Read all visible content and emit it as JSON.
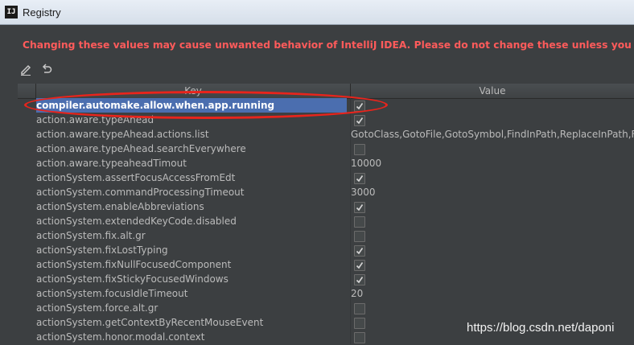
{
  "window": {
    "title": "Registry",
    "app_icon_label": "IJ"
  },
  "warning": {
    "icon": "warning-triangle-icon",
    "text": "Changing these values may cause unwanted behavior of IntelliJ IDEA. Please do not change these unless you have bee"
  },
  "toolbar": {
    "items": [
      "edit-icon",
      "revert-icon"
    ]
  },
  "table": {
    "columns": {
      "key": "Key",
      "value": "Value"
    },
    "rows": [
      {
        "key": "compiler.automake.allow.when.app.running",
        "type": "checkbox",
        "checked": true,
        "selected": true
      },
      {
        "key": "action.aware.typeAhead",
        "type": "checkbox",
        "checked": true
      },
      {
        "key": "action.aware.typeAhead.actions.list",
        "type": "text",
        "value": "GotoClass,GotoFile,GotoSymbol,FindInPath,ReplaceInPath,File"
      },
      {
        "key": "action.aware.typeAhead.searchEverywhere",
        "type": "checkbox",
        "checked": false
      },
      {
        "key": "action.aware.typeaheadTimout",
        "type": "text",
        "value": "10000"
      },
      {
        "key": "actionSystem.assertFocusAccessFromEdt",
        "type": "checkbox",
        "checked": true
      },
      {
        "key": "actionSystem.commandProcessingTimeout",
        "type": "text",
        "value": "3000"
      },
      {
        "key": "actionSystem.enableAbbreviations",
        "type": "checkbox",
        "checked": true
      },
      {
        "key": "actionSystem.extendedKeyCode.disabled",
        "type": "checkbox",
        "checked": false
      },
      {
        "key": "actionSystem.fix.alt.gr",
        "type": "checkbox",
        "checked": false
      },
      {
        "key": "actionSystem.fixLostTyping",
        "type": "checkbox",
        "checked": true
      },
      {
        "key": "actionSystem.fixNullFocusedComponent",
        "type": "checkbox",
        "checked": true
      },
      {
        "key": "actionSystem.fixStickyFocusedWindows",
        "type": "checkbox",
        "checked": true
      },
      {
        "key": "actionSystem.focusIdleTimeout",
        "type": "text",
        "value": "20"
      },
      {
        "key": "actionSystem.force.alt.gr",
        "type": "checkbox",
        "checked": false
      },
      {
        "key": "actionSystem.getContextByRecentMouseEvent",
        "type": "checkbox",
        "checked": false
      },
      {
        "key": "actionSystem.honor.modal.context",
        "type": "checkbox",
        "checked": false
      }
    ]
  },
  "watermark": "https://blog.csdn.net/daponi",
  "colors": {
    "background": "#3c3f41",
    "warning_text": "#ff5b5b",
    "selection": "#4b6eaf",
    "annotation": "#e8241c"
  }
}
